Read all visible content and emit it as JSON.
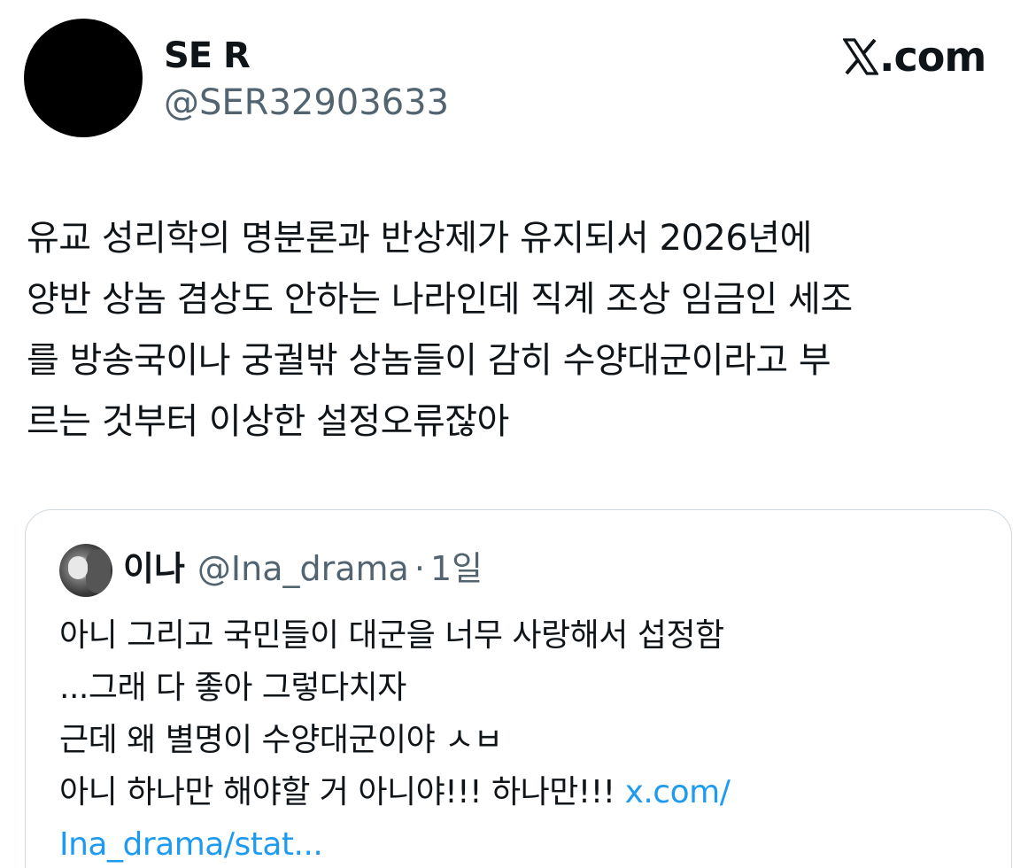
{
  "author": {
    "display_name": "SE R",
    "handle": "@SER32903633"
  },
  "brand": {
    "logo_icon": "x-logo-icon",
    "text": ".com"
  },
  "tweet": {
    "lines": [
      "유교 성리학의 명분론과 반상제가 유지되서 2026년에",
      "양반 상놈 겸상도 안하는 나라인데 직계 조상 임금인 세조",
      "를 방송국이나 궁궐밖 상놈들이 감히 수양대군이라고 부",
      "르는 것부터 이상한 설정오류잖아"
    ]
  },
  "quote": {
    "name": "이나",
    "handle": "@Ina_drama",
    "separator": "·",
    "time": "1일",
    "lines": [
      "아니 그리고 국민들이 대군을 너무 사랑해서 섭정함",
      "...그래 다 좋아 그렇다치자",
      "근데 왜 별명이 수양대군이야 ㅅㅂ",
      "아니 하나만 해야할 거 아니야!!! 하나만!!! "
    ],
    "link_part1": "x.com/",
    "link_part2": "Ina_drama/stat..."
  },
  "colors": {
    "text": "#0f1419",
    "secondary": "#536471",
    "link": "#1d9bf0",
    "border": "#cfd9de"
  }
}
